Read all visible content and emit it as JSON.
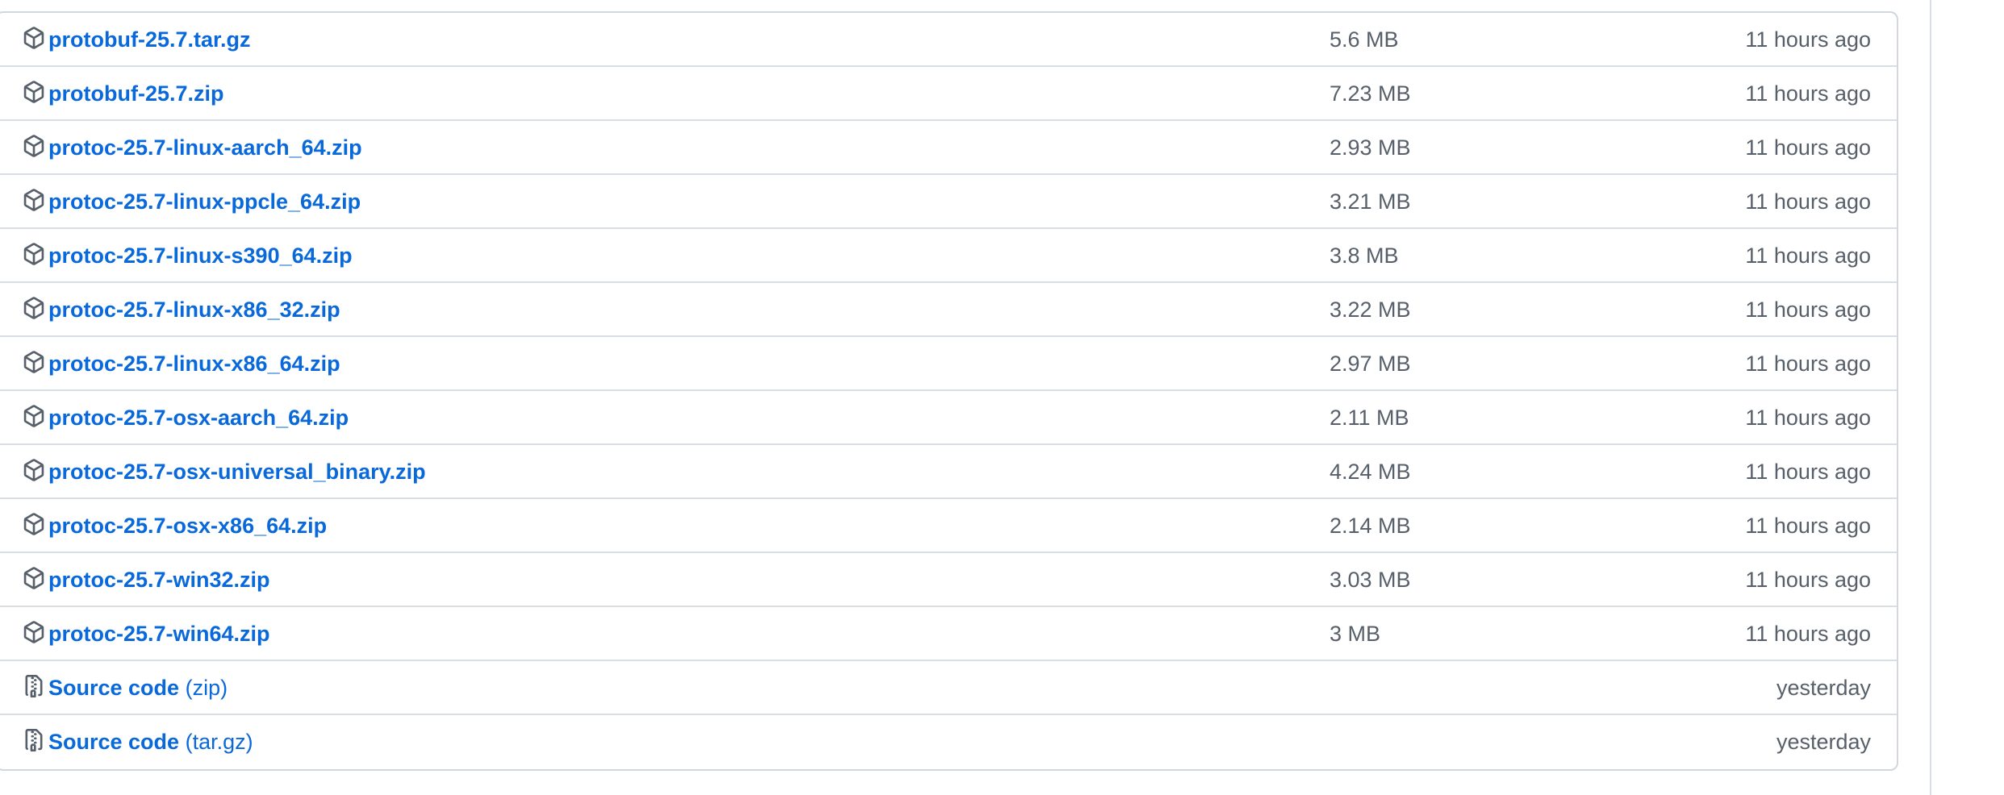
{
  "assets": [
    {
      "name": "protobuf-25.7.tar.gz",
      "size": "5.6 MB",
      "time": "11 hours ago"
    },
    {
      "name": "protobuf-25.7.zip",
      "size": "7.23 MB",
      "time": "11 hours ago"
    },
    {
      "name": "protoc-25.7-linux-aarch_64.zip",
      "size": "2.93 MB",
      "time": "11 hours ago"
    },
    {
      "name": "protoc-25.7-linux-ppcle_64.zip",
      "size": "3.21 MB",
      "time": "11 hours ago"
    },
    {
      "name": "protoc-25.7-linux-s390_64.zip",
      "size": "3.8 MB",
      "time": "11 hours ago"
    },
    {
      "name": "protoc-25.7-linux-x86_32.zip",
      "size": "3.22 MB",
      "time": "11 hours ago"
    },
    {
      "name": "protoc-25.7-linux-x86_64.zip",
      "size": "2.97 MB",
      "time": "11 hours ago"
    },
    {
      "name": "protoc-25.7-osx-aarch_64.zip",
      "size": "2.11 MB",
      "time": "11 hours ago"
    },
    {
      "name": "protoc-25.7-osx-universal_binary.zip",
      "size": "4.24 MB",
      "time": "11 hours ago"
    },
    {
      "name": "protoc-25.7-osx-x86_64.zip",
      "size": "2.14 MB",
      "time": "11 hours ago"
    },
    {
      "name": "protoc-25.7-win32.zip",
      "size": "3.03 MB",
      "time": "11 hours ago"
    },
    {
      "name": "protoc-25.7-win64.zip",
      "size": "3 MB",
      "time": "11 hours ago"
    }
  ],
  "source_code": [
    {
      "label": "Source code",
      "suffix": "(zip)",
      "time": "yesterday"
    },
    {
      "label": "Source code",
      "suffix": "(tar.gz)",
      "time": "yesterday"
    }
  ],
  "icons": {
    "asset": "package-icon",
    "source": "file-zip-icon"
  },
  "colors": {
    "link": "#0969da",
    "muted": "#57606a",
    "border": "#d0d7de"
  }
}
